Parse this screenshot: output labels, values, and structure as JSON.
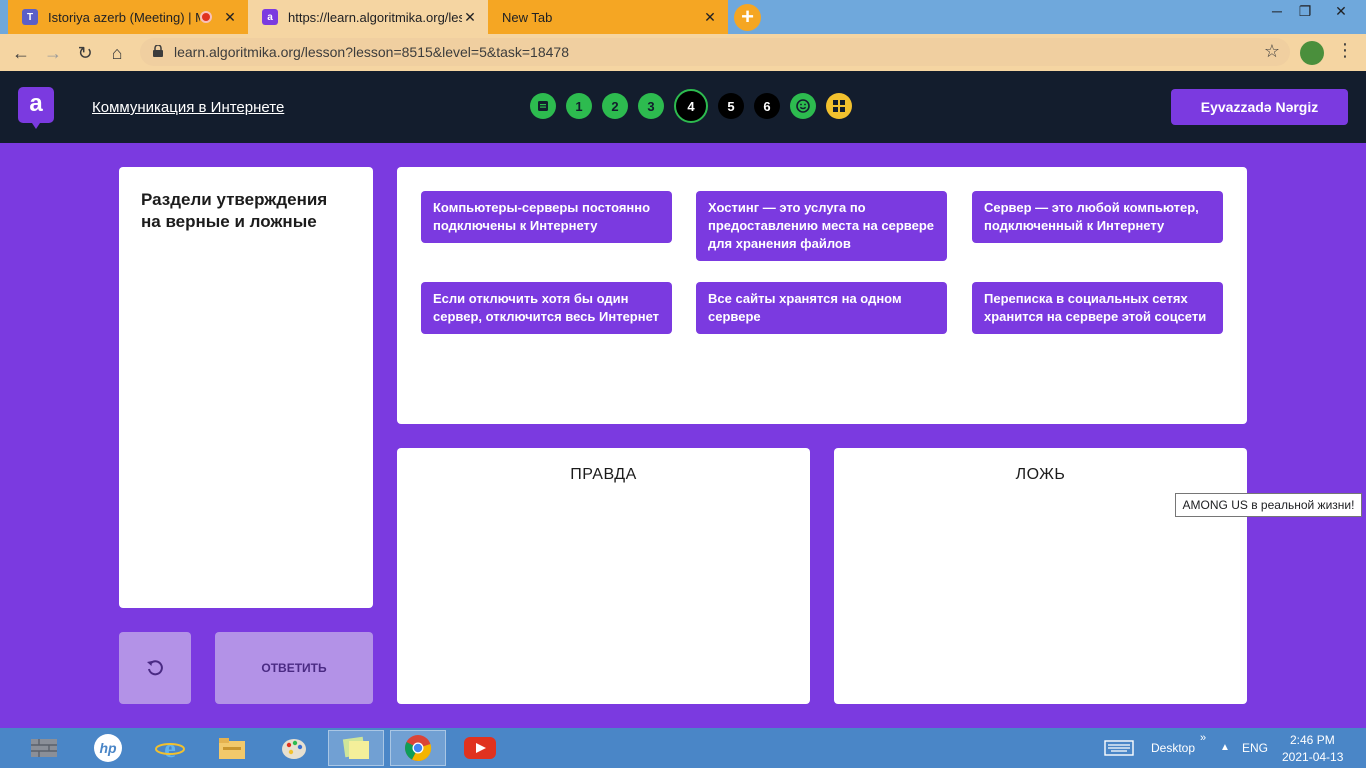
{
  "browser": {
    "tabs": [
      {
        "title": "Istoriya azerb (Meeting) | Mi",
        "close": "✕"
      },
      {
        "title": "https://learn.algoritmika.org/less",
        "close": "✕"
      },
      {
        "title": "New Tab",
        "close": "✕"
      }
    ],
    "new_tab": "+",
    "url": "learn.algoritmika.org/lesson?lesson=8515&level=5&task=18478"
  },
  "header": {
    "logo": "a",
    "lesson_title": "Коммуникация в Интернете",
    "steps": [
      "1",
      "2",
      "3",
      "4",
      "5",
      "6"
    ],
    "user_name": "Eyvazzadə Nərgiz"
  },
  "task": {
    "instruction": "Раздели утверждения на верные и ложные",
    "answer_button": "ОТВЕТИТЬ"
  },
  "cards": [
    "Компьютеры-серверы постоянно подключены к Интернету",
    "Хостинг — это услуга по предоставлению места на сервере для хранения файлов",
    "Сервер — это любой компьютер, подключенный к Интернету",
    "Если отключить хотя бы один сервер, отключится весь Интернет",
    "Все сайты хранятся на одном сервере",
    "Переписка в социальных сетях хранится на сервере этой соцсети"
  ],
  "drop_zones": {
    "true_label": "ПРАВДА",
    "false_label": "ЛОЖЬ"
  },
  "tooltip": "AMONG US в реальной жизни!",
  "taskbar": {
    "desktop": "Desktop",
    "lang": "ENG",
    "time": "2:46 PM",
    "date": "2021-04-13"
  },
  "colors": {
    "brand": "#7b3ae0",
    "header_bg": "#131d2d",
    "done_step": "#2dbb4f"
  }
}
